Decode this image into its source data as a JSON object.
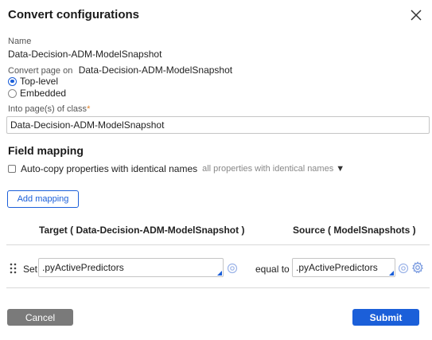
{
  "dialog": {
    "title": "Convert configurations"
  },
  "name": {
    "label": "Name",
    "value": "Data-Decision-ADM-ModelSnapshot"
  },
  "convert_page_on": {
    "label": "Convert page on",
    "value": "Data-Decision-ADM-ModelSnapshot",
    "options": [
      {
        "label": "Top-level",
        "selected": true
      },
      {
        "label": "Embedded",
        "selected": false
      }
    ]
  },
  "into_class": {
    "label": "Into page(s) of class",
    "required_marker": "*",
    "value": "Data-Decision-ADM-ModelSnapshot"
  },
  "field_mapping": {
    "heading": "Field mapping",
    "autocopy_label": "Auto-copy properties with identical names",
    "autocopy_checked": false,
    "autocopy_option": "all properties with identical names",
    "add_mapping_label": "Add mapping",
    "target_header": "Target ( Data-Decision-ADM-ModelSnapshot )",
    "source_header": "Source ( ModelSnapshots )",
    "rows": [
      {
        "action": "Set",
        "target": ".pyActivePredictors",
        "operator": "equal to",
        "source": ".pyActivePredictors"
      }
    ]
  },
  "footer": {
    "cancel_label": "Cancel",
    "submit_label": "Submit"
  },
  "colors": {
    "accent": "#1b5fd9",
    "required": "#e0822b",
    "cancel_bg": "#7a7a7a"
  }
}
